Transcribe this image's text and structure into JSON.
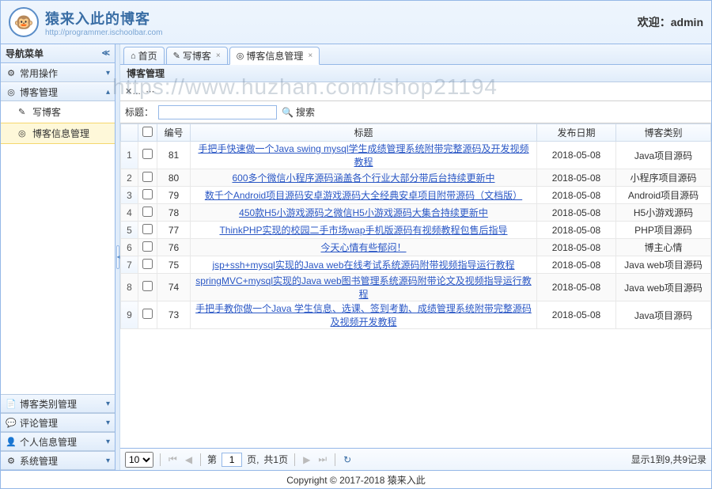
{
  "header": {
    "title": "猿来入此的博客",
    "subtitle": "http://programmer.ischoolbar.com",
    "welcome_label": "欢迎：",
    "welcome_user": "admin",
    "logo_face": "🐵"
  },
  "sidebar": {
    "title": "导航菜单",
    "sections": [
      {
        "icon": "⚙",
        "label": "常用操作",
        "expanded": false
      },
      {
        "icon": "◎",
        "label": "博客管理",
        "expanded": true,
        "children": [
          {
            "icon": "✎",
            "label": "写博客"
          },
          {
            "icon": "◎",
            "label": "博客信息管理",
            "selected": true
          }
        ]
      }
    ],
    "bottom": [
      {
        "icon": "📄",
        "label": "博客类别管理"
      },
      {
        "icon": "💬",
        "label": "评论管理"
      },
      {
        "icon": "👤",
        "label": "个人信息管理"
      },
      {
        "icon": "⚙",
        "label": "系统管理"
      }
    ]
  },
  "tabs": [
    {
      "icon": "⌂",
      "label": "首页",
      "closable": false
    },
    {
      "icon": "✎",
      "label": "写博客",
      "closable": true
    },
    {
      "icon": "◎",
      "label": "博客信息管理",
      "closable": true,
      "active": true
    }
  ],
  "panel": {
    "title": "博客管理"
  },
  "watermark": "https://www.huzhan.com/ishop21194",
  "search": {
    "label": "标题：",
    "placeholder": "",
    "btn_icon": "🔍",
    "btn_label": "搜索"
  },
  "grid": {
    "columns": {
      "id": "编号",
      "title": "标题",
      "date": "发布日期",
      "category": "博客类别"
    },
    "rows": [
      {
        "id": "81",
        "title": "手把手快速做一个Java swing mysql学生成绩管理系统附带完整源码及开发视频教程",
        "date": "2018-05-08",
        "category": "Java项目源码"
      },
      {
        "id": "80",
        "title": "600多个微信小程序源码涵盖各个行业大部分带后台持续更新中",
        "date": "2018-05-08",
        "category": "小程序项目源码"
      },
      {
        "id": "79",
        "title": "数千个Android项目源码安卓游戏源码大全经典安卓项目附带源码（文档版）",
        "date": "2018-05-08",
        "category": "Android项目源码"
      },
      {
        "id": "78",
        "title": "450款H5小游戏源码之微信H5小游戏源码大集合持续更新中",
        "date": "2018-05-08",
        "category": "H5小游戏源码"
      },
      {
        "id": "77",
        "title": "ThinkPHP实现的校园二手市场wap手机版源码有视频教程包售后指导",
        "date": "2018-05-08",
        "category": "PHP项目源码"
      },
      {
        "id": "76",
        "title": "今天心情有些郁闷！",
        "date": "2018-05-08",
        "category": "博主心情"
      },
      {
        "id": "75",
        "title": "jsp+ssh+mysql实现的Java web在线考试系统源码附带视频指导运行教程",
        "date": "2018-05-08",
        "category": "Java web项目源码"
      },
      {
        "id": "74",
        "title": "springMVC+mysql实现的Java web图书管理系统源码附带论文及视频指导运行教程",
        "date": "2018-05-08",
        "category": "Java web项目源码"
      },
      {
        "id": "73",
        "title": "手把手教你做一个Java 学生信息、选课、签到考勤、成绩管理系统附带完整源码及视频开发教程",
        "date": "2018-05-08",
        "category": "Java项目源码"
      }
    ]
  },
  "pager": {
    "page_size": "10",
    "page_label_prefix": "第",
    "current_page": "1",
    "page_label_suffix": "页,",
    "total_pages": "共1页",
    "info": "显示1到9,共9记录"
  },
  "footer": "Copyright © 2017-2018 猿来入此"
}
